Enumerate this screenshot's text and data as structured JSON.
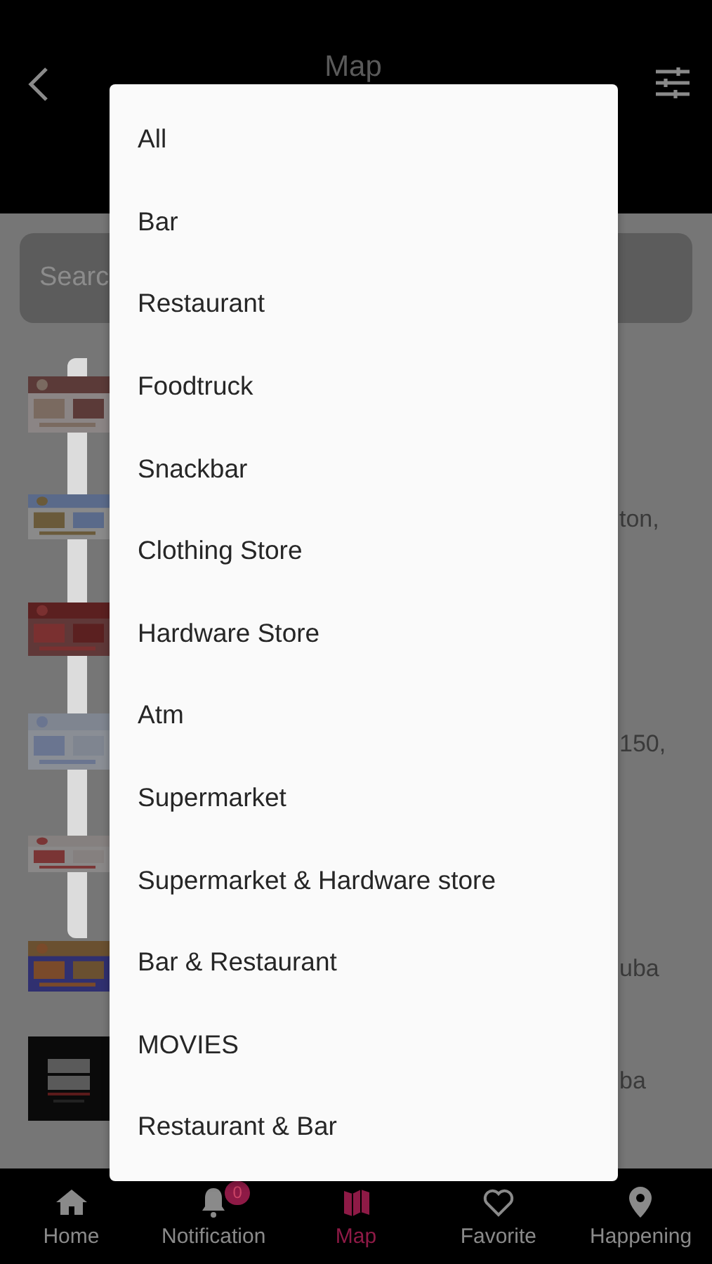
{
  "header": {
    "title": "Map"
  },
  "search": {
    "placeholder": "Searc"
  },
  "places": [
    {
      "kind": "picture"
    },
    {
      "kind": "picture",
      "text": "ton,"
    },
    {
      "kind": "picture"
    },
    {
      "kind": "picture",
      "text": "150,"
    },
    {
      "kind": "picture"
    },
    {
      "kind": "picture",
      "text": "uba"
    },
    {
      "kind": "picture",
      "text": "ba"
    }
  ],
  "filter_menu": {
    "options": [
      "All",
      "Bar",
      "Restaurant",
      "Foodtruck",
      "Snackbar",
      "Clothing Store",
      "Hardware Store",
      "Atm",
      "Supermarket",
      "Supermarket & Hardware store",
      "Bar & Restaurant",
      "MOVIES",
      "Restaurant & Bar"
    ]
  },
  "bottom_nav": [
    {
      "label": "Home",
      "kind": "home",
      "selected": false
    },
    {
      "label": "Notification",
      "kind": "bell",
      "selected": false,
      "badge": "0"
    },
    {
      "label": "Map",
      "kind": "map",
      "selected": true
    },
    {
      "label": "Favorite",
      "kind": "heart",
      "selected": false
    },
    {
      "label": "Happening",
      "kind": "pin",
      "selected": false
    }
  ]
}
